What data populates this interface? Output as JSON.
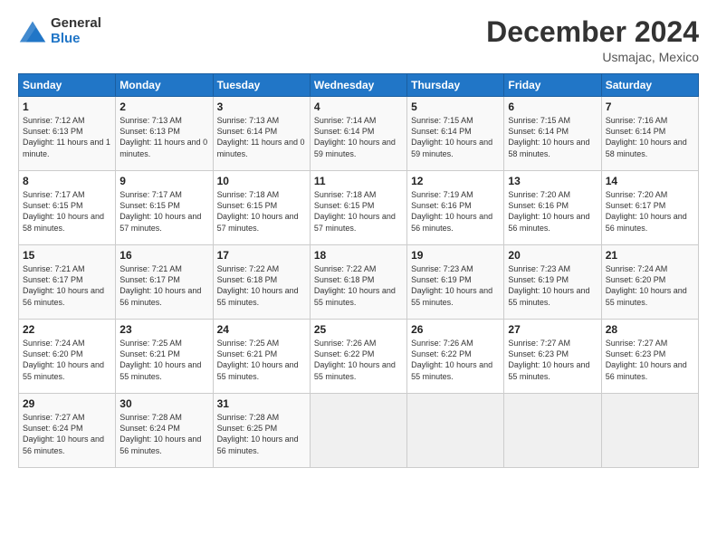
{
  "logo": {
    "general": "General",
    "blue": "Blue"
  },
  "header": {
    "month": "December 2024",
    "location": "Usmajac, Mexico"
  },
  "weekdays": [
    "Sunday",
    "Monday",
    "Tuesday",
    "Wednesday",
    "Thursday",
    "Friday",
    "Saturday"
  ],
  "weeks": [
    [
      {
        "day": "1",
        "sunrise": "7:12 AM",
        "sunset": "6:13 PM",
        "daylight": "11 hours and 1 minute."
      },
      {
        "day": "2",
        "sunrise": "7:13 AM",
        "sunset": "6:13 PM",
        "daylight": "11 hours and 0 minutes."
      },
      {
        "day": "3",
        "sunrise": "7:13 AM",
        "sunset": "6:14 PM",
        "daylight": "11 hours and 0 minutes."
      },
      {
        "day": "4",
        "sunrise": "7:14 AM",
        "sunset": "6:14 PM",
        "daylight": "10 hours and 59 minutes."
      },
      {
        "day": "5",
        "sunrise": "7:15 AM",
        "sunset": "6:14 PM",
        "daylight": "10 hours and 59 minutes."
      },
      {
        "day": "6",
        "sunrise": "7:15 AM",
        "sunset": "6:14 PM",
        "daylight": "10 hours and 58 minutes."
      },
      {
        "day": "7",
        "sunrise": "7:16 AM",
        "sunset": "6:14 PM",
        "daylight": "10 hours and 58 minutes."
      }
    ],
    [
      {
        "day": "8",
        "sunrise": "7:17 AM",
        "sunset": "6:15 PM",
        "daylight": "10 hours and 58 minutes."
      },
      {
        "day": "9",
        "sunrise": "7:17 AM",
        "sunset": "6:15 PM",
        "daylight": "10 hours and 57 minutes."
      },
      {
        "day": "10",
        "sunrise": "7:18 AM",
        "sunset": "6:15 PM",
        "daylight": "10 hours and 57 minutes."
      },
      {
        "day": "11",
        "sunrise": "7:18 AM",
        "sunset": "6:15 PM",
        "daylight": "10 hours and 57 minutes."
      },
      {
        "day": "12",
        "sunrise": "7:19 AM",
        "sunset": "6:16 PM",
        "daylight": "10 hours and 56 minutes."
      },
      {
        "day": "13",
        "sunrise": "7:20 AM",
        "sunset": "6:16 PM",
        "daylight": "10 hours and 56 minutes."
      },
      {
        "day": "14",
        "sunrise": "7:20 AM",
        "sunset": "6:17 PM",
        "daylight": "10 hours and 56 minutes."
      }
    ],
    [
      {
        "day": "15",
        "sunrise": "7:21 AM",
        "sunset": "6:17 PM",
        "daylight": "10 hours and 56 minutes."
      },
      {
        "day": "16",
        "sunrise": "7:21 AM",
        "sunset": "6:17 PM",
        "daylight": "10 hours and 56 minutes."
      },
      {
        "day": "17",
        "sunrise": "7:22 AM",
        "sunset": "6:18 PM",
        "daylight": "10 hours and 55 minutes."
      },
      {
        "day": "18",
        "sunrise": "7:22 AM",
        "sunset": "6:18 PM",
        "daylight": "10 hours and 55 minutes."
      },
      {
        "day": "19",
        "sunrise": "7:23 AM",
        "sunset": "6:19 PM",
        "daylight": "10 hours and 55 minutes."
      },
      {
        "day": "20",
        "sunrise": "7:23 AM",
        "sunset": "6:19 PM",
        "daylight": "10 hours and 55 minutes."
      },
      {
        "day": "21",
        "sunrise": "7:24 AM",
        "sunset": "6:20 PM",
        "daylight": "10 hours and 55 minutes."
      }
    ],
    [
      {
        "day": "22",
        "sunrise": "7:24 AM",
        "sunset": "6:20 PM",
        "daylight": "10 hours and 55 minutes."
      },
      {
        "day": "23",
        "sunrise": "7:25 AM",
        "sunset": "6:21 PM",
        "daylight": "10 hours and 55 minutes."
      },
      {
        "day": "24",
        "sunrise": "7:25 AM",
        "sunset": "6:21 PM",
        "daylight": "10 hours and 55 minutes."
      },
      {
        "day": "25",
        "sunrise": "7:26 AM",
        "sunset": "6:22 PM",
        "daylight": "10 hours and 55 minutes."
      },
      {
        "day": "26",
        "sunrise": "7:26 AM",
        "sunset": "6:22 PM",
        "daylight": "10 hours and 55 minutes."
      },
      {
        "day": "27",
        "sunrise": "7:27 AM",
        "sunset": "6:23 PM",
        "daylight": "10 hours and 55 minutes."
      },
      {
        "day": "28",
        "sunrise": "7:27 AM",
        "sunset": "6:23 PM",
        "daylight": "10 hours and 56 minutes."
      }
    ],
    [
      {
        "day": "29",
        "sunrise": "7:27 AM",
        "sunset": "6:24 PM",
        "daylight": "10 hours and 56 minutes."
      },
      {
        "day": "30",
        "sunrise": "7:28 AM",
        "sunset": "6:24 PM",
        "daylight": "10 hours and 56 minutes."
      },
      {
        "day": "31",
        "sunrise": "7:28 AM",
        "sunset": "6:25 PM",
        "daylight": "10 hours and 56 minutes."
      },
      null,
      null,
      null,
      null
    ]
  ],
  "labels": {
    "sunrise": "Sunrise:",
    "sunset": "Sunset:",
    "daylight": "Daylight:"
  }
}
